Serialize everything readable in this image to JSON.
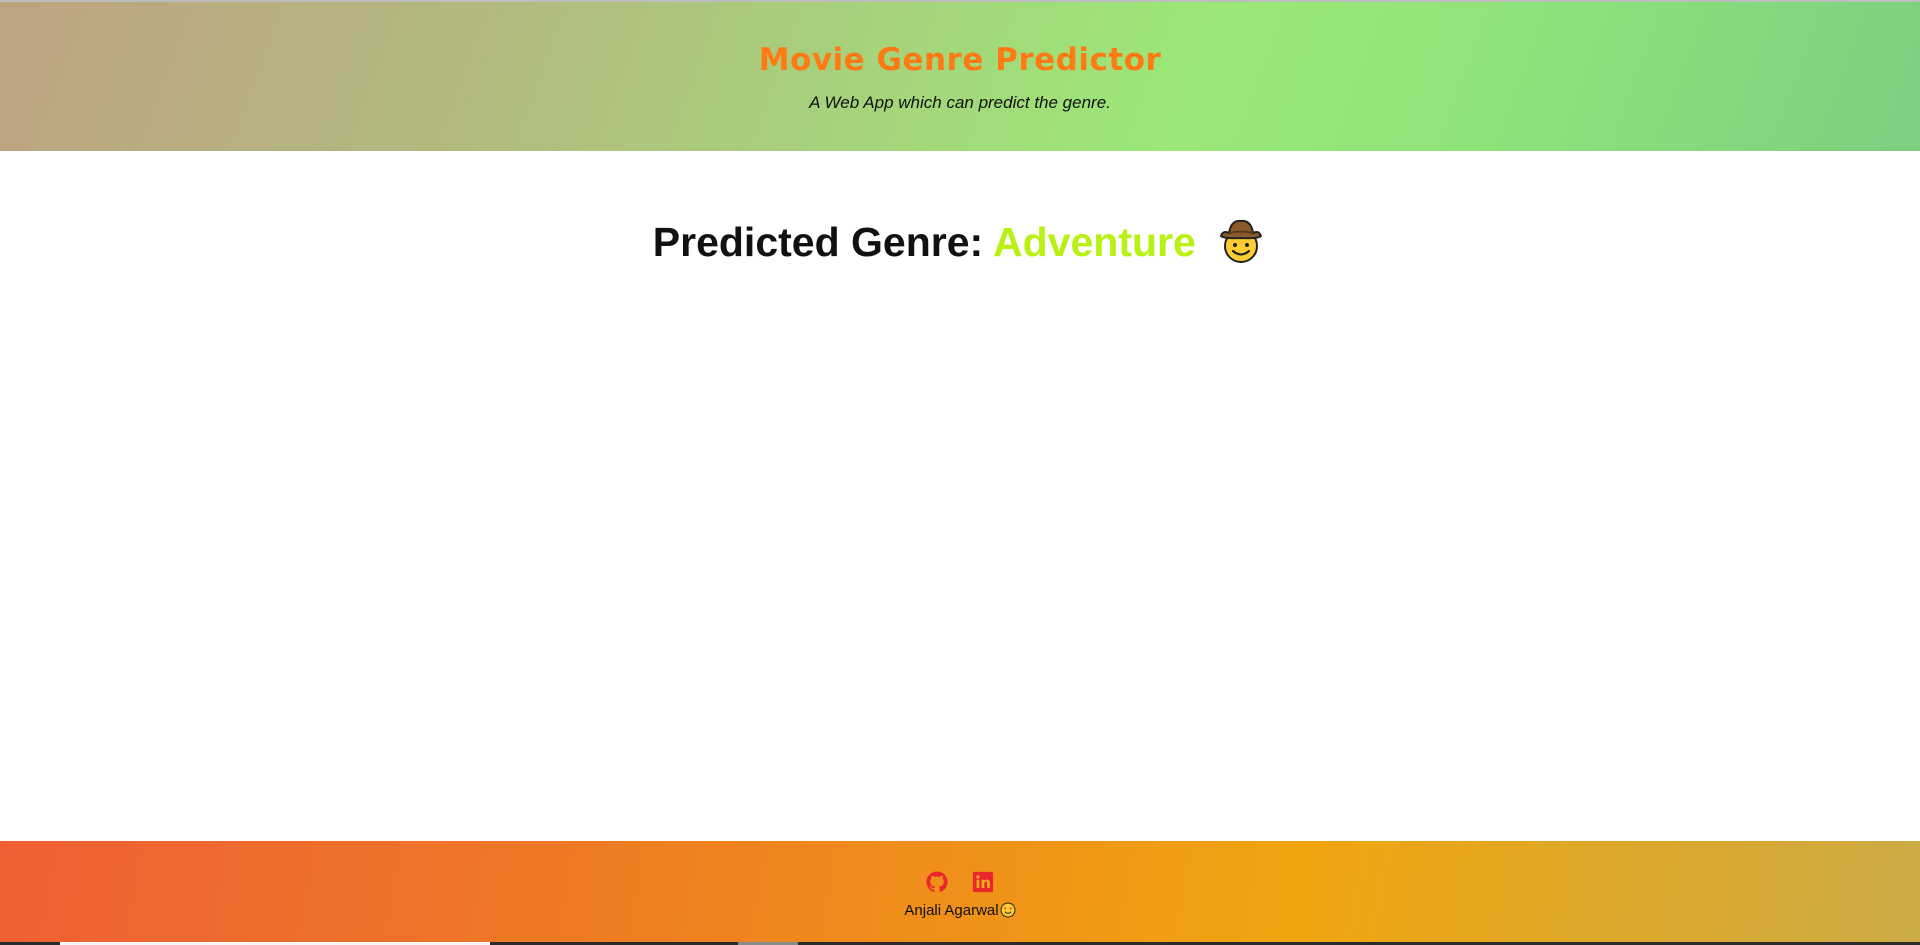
{
  "header": {
    "title": "Movie Genre Predictor",
    "subtitle": "A Web App which can predict the genre."
  },
  "result": {
    "label": "Predicted Genre:",
    "genre": "Adventure",
    "emoji_icon": "cowboy-face-icon",
    "genre_color": "#b8f212"
  },
  "footer": {
    "links": [
      {
        "icon": "github-icon"
      },
      {
        "icon": "linkedin-icon"
      }
    ],
    "author": "Anjali Agarwal",
    "author_emoji_icon": "smiling-face-with-heart-eyes-icon"
  },
  "colors": {
    "title": "#ff7a12",
    "footer_icon": "#e8262b"
  }
}
